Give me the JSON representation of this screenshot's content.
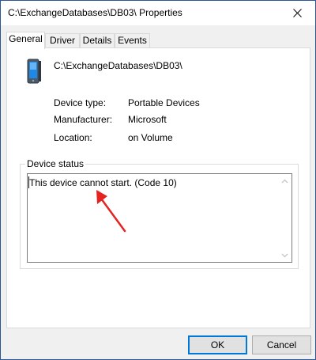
{
  "window": {
    "title": "C:\\ExchangeDatabases\\DB03\\ Properties"
  },
  "tabs": [
    {
      "label": "General",
      "active": true
    },
    {
      "label": "Driver",
      "active": false
    },
    {
      "label": "Details",
      "active": false
    },
    {
      "label": "Events",
      "active": false
    }
  ],
  "device": {
    "name": "C:\\ExchangeDatabases\\DB03\\",
    "icon": "portable-device-icon"
  },
  "properties": [
    {
      "label": "Device type:",
      "value": "Portable Devices"
    },
    {
      "label": "Manufacturer:",
      "value": "Microsoft"
    },
    {
      "label": "Location:",
      "value": "on Volume"
    }
  ],
  "status": {
    "group_title": "Device status",
    "text": "This device cannot start. (Code 10)"
  },
  "buttons": {
    "ok_label": "OK",
    "cancel_label": "Cancel"
  },
  "colors": {
    "accent": "#0078d7",
    "annotation": "#e52421"
  }
}
